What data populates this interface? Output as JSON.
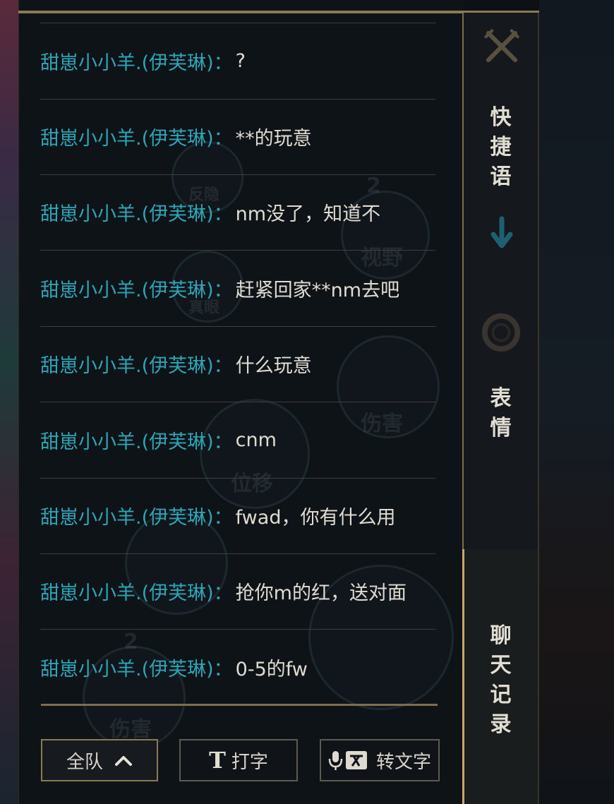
{
  "chat": {
    "messages": [
      {
        "sender": "甜崽小小羊.(伊芙琳)：",
        "text": "?"
      },
      {
        "sender": "甜崽小小羊.(伊芙琳)：",
        "text": "**的玩意"
      },
      {
        "sender": "甜崽小小羊.(伊芙琳)：",
        "text": "nm没了，知道不"
      },
      {
        "sender": "甜崽小小羊.(伊芙琳)：",
        "text": "赶紧回家**nm去吧"
      },
      {
        "sender": "甜崽小小羊.(伊芙琳)：",
        "text": "什么玩意"
      },
      {
        "sender": "甜崽小小羊.(伊芙琳)：",
        "text": "cnm"
      },
      {
        "sender": "甜崽小小羊.(伊芙琳)：",
        "text": "fwad，你有什么用"
      },
      {
        "sender": "甜崽小小羊.(伊芙琳)：",
        "text": "抢你m的红，送对面"
      },
      {
        "sender": "甜崽小小羊.(伊芙琳)：",
        "text": "0-5的fw"
      }
    ]
  },
  "bottom": {
    "team_label": "全队",
    "type_glyph": "T",
    "type_label": "打字",
    "voice_label": "转文字"
  },
  "side": {
    "quick_phrase": [
      "快",
      "捷",
      "语"
    ],
    "emote": [
      "表",
      "情"
    ],
    "chat_log": [
      "聊",
      "天",
      "记",
      "录"
    ]
  },
  "background": {
    "words": [
      "反隐",
      "视野",
      "真眼",
      "伤害",
      "位移",
      "伤害"
    ],
    "badges": [
      "2",
      "2"
    ]
  },
  "colors": {
    "sender": "#2ea5b5",
    "message": "#e0dcd2",
    "gold_border": "#8b7a55",
    "active_tab_marker": "#c9a86a"
  }
}
